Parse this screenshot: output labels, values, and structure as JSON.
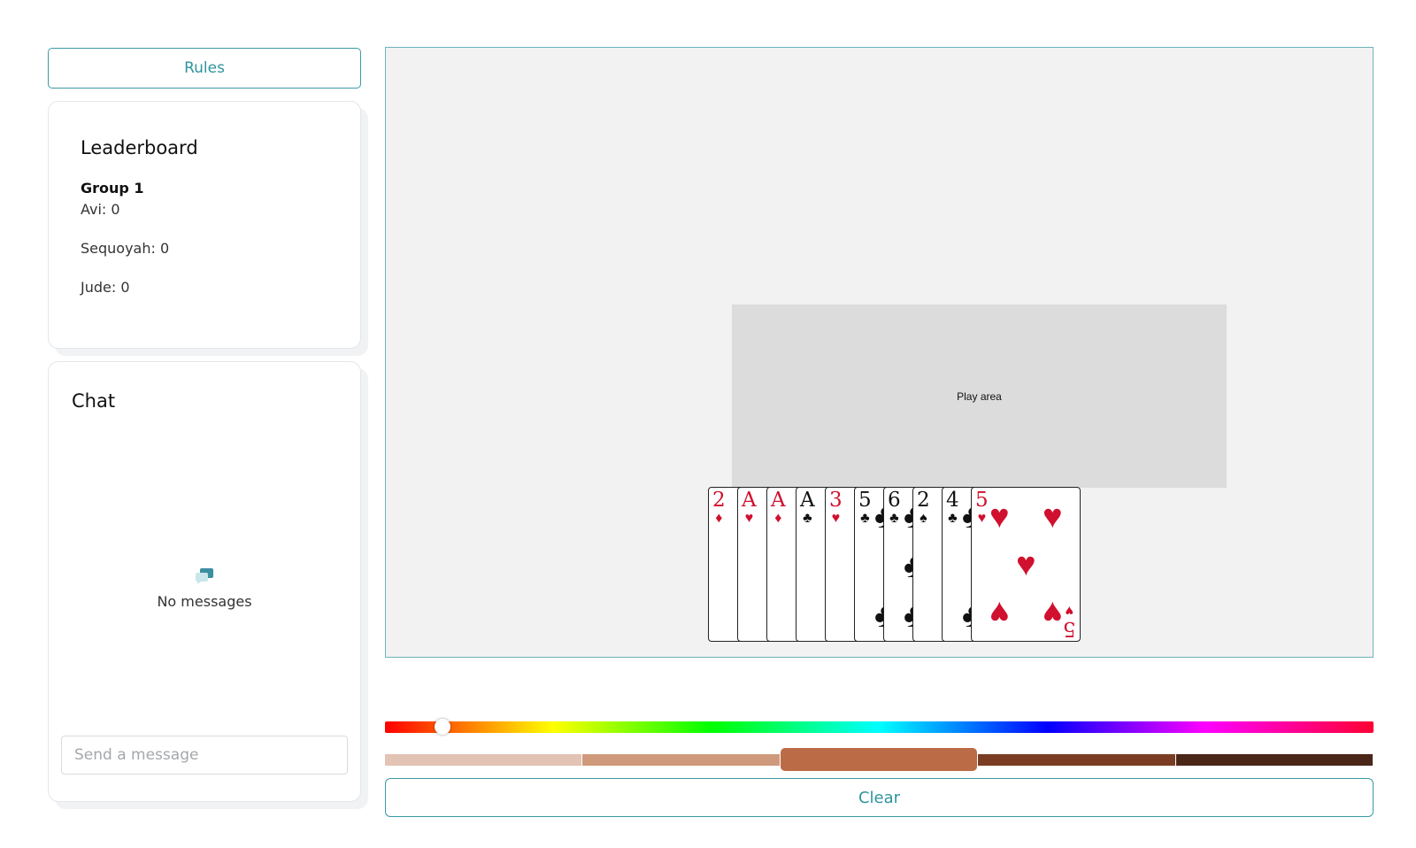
{
  "rules_label": "Rules",
  "leaderboard": {
    "title": "Leaderboard",
    "group": "Group 1",
    "players": [
      {
        "name": "Avi",
        "score": "Avi: 0"
      },
      {
        "name": "Sequoyah",
        "score": "Sequoyah: 0"
      },
      {
        "name": "Jude",
        "score": "Jude: 0"
      }
    ]
  },
  "chat": {
    "title": "Chat",
    "empty_text": "No messages",
    "placeholder": "Send a message",
    "empty_icon": "chat-bubbles-icon"
  },
  "board": {
    "play_area_label": "Play area",
    "hand": [
      {
        "rank": "2",
        "suit": "♦",
        "color": "red"
      },
      {
        "rank": "A",
        "suit": "♥",
        "color": "red"
      },
      {
        "rank": "A",
        "suit": "♦",
        "color": "red"
      },
      {
        "rank": "A",
        "suit": "♣",
        "color": "blk"
      },
      {
        "rank": "3",
        "suit": "♥",
        "color": "red"
      },
      {
        "rank": "5",
        "suit": "♣",
        "color": "blk"
      },
      {
        "rank": "6",
        "suit": "♣",
        "color": "blk"
      },
      {
        "rank": "2",
        "suit": "♠",
        "color": "blk"
      },
      {
        "rank": "4",
        "suit": "♣",
        "color": "blk"
      },
      {
        "rank": "5",
        "suit": "♥",
        "color": "red"
      }
    ]
  },
  "color_picker": {
    "hue_position": 0.058,
    "skin_swatches": [
      "#e3c3b3",
      "#cf9a7b",
      "#bb6b45",
      "#7a3d24",
      "#4a2618"
    ],
    "selected_swatch": 2
  },
  "clear_label": "Clear",
  "colors": {
    "accent": "#2f949f",
    "suit_red": "#d0102e"
  }
}
